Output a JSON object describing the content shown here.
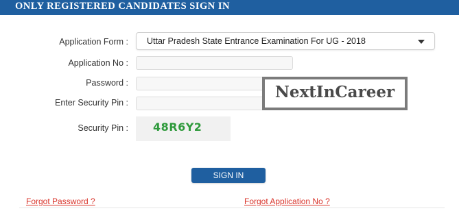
{
  "header": {
    "title": "ONLY REGISTERED CANDIDATES SIGN IN"
  },
  "form": {
    "application_form_label": "Application Form :",
    "application_form_value": "Uttar Pradesh State Entrance Examination For UG - 2018",
    "application_no_label": "Application No :",
    "application_no_value": "",
    "password_label": "Password :",
    "password_value": "",
    "security_pin_input_label": "Enter Security Pin :",
    "security_pin_input_value": "",
    "security_pin_label": "Security Pin :",
    "security_pin_code": "48R6Y2"
  },
  "watermark": {
    "text": "NextInCareer"
  },
  "actions": {
    "sign_in_label": "SIGN IN"
  },
  "links": {
    "forgot_password": "Forgot Password ?",
    "forgot_application_no": "Forgot Application No ?"
  },
  "colors": {
    "brand_blue": "#1f5fa0",
    "captcha_green": "#2f9a3c",
    "link_red": "#d9342b"
  },
  "icons": {
    "dropdown": "chevron-down-icon"
  }
}
